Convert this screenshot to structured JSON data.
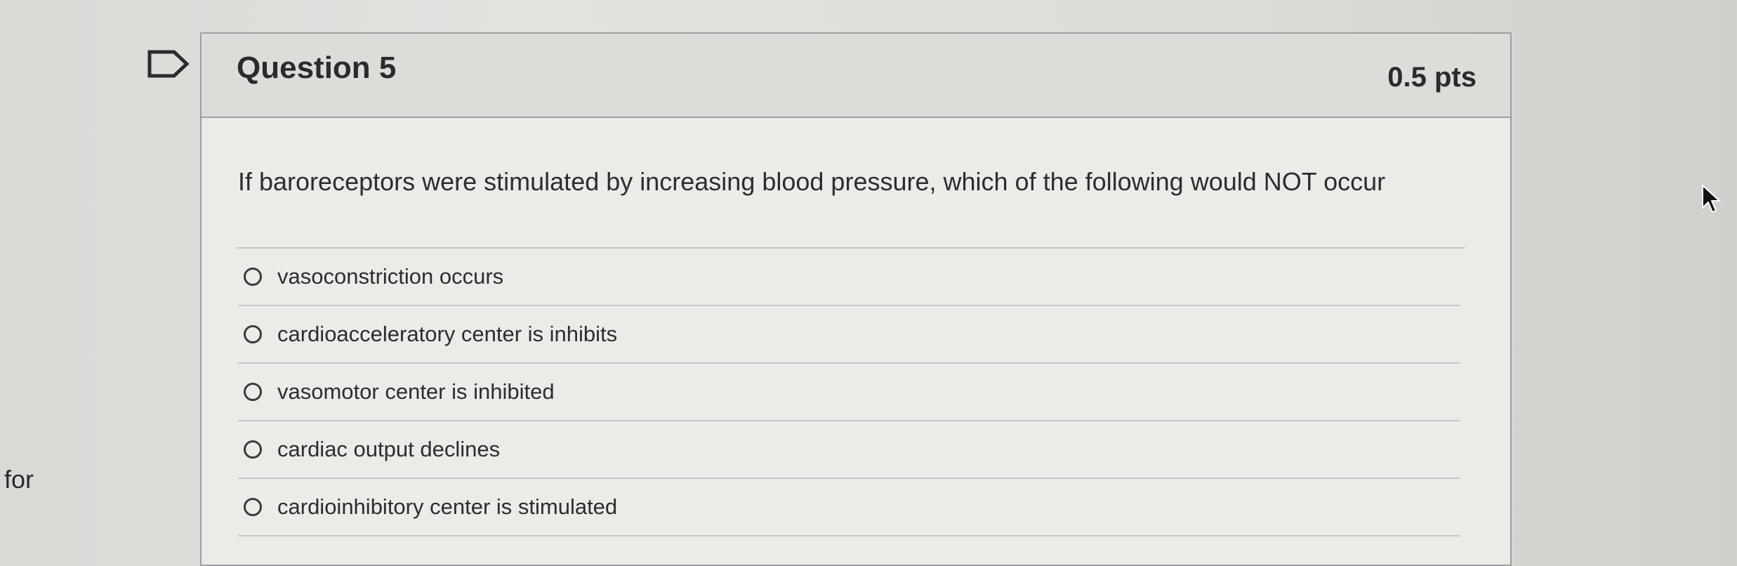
{
  "side": {
    "label": "for"
  },
  "question": {
    "title": "Question 5",
    "points": "0.5 pts",
    "text": "If baroreceptors were stimulated by increasing blood pressure, which of the following would NOT occur",
    "flag_icon": "flag-icon"
  },
  "answers": [
    {
      "label": "vasoconstriction occurs",
      "selected": false
    },
    {
      "label": "cardioacceleratory center is inhibits",
      "selected": false
    },
    {
      "label": "vasomotor center is inhibited",
      "selected": false
    },
    {
      "label": "cardiac output declines",
      "selected": false
    },
    {
      "label": "cardioinhibitory center is stimulated",
      "selected": false
    }
  ],
  "cursor": {
    "icon": "mouse-pointer-icon"
  },
  "colors": {
    "page_background": "#e2e2df",
    "card_background": "#ebebe8",
    "header_background": "#dcdcd9",
    "border": "#9aa0a3",
    "text": "#2d2d2d"
  }
}
